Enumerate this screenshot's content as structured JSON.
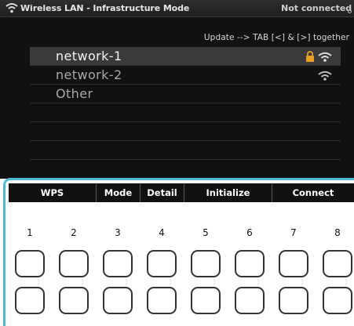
{
  "titlebar": {
    "title": "Wireless LAN - Infrastructure Mode",
    "status": "Not connected",
    "icon": "wifi-icon"
  },
  "hint": "Update --> TAB [<] & [>] together",
  "networks": [
    {
      "name": "network-1",
      "selected": true,
      "locked": true,
      "signal": true
    },
    {
      "name": "network-2",
      "selected": false,
      "locked": false,
      "signal": true
    },
    {
      "name": "Other",
      "selected": false,
      "locked": false,
      "signal": false
    }
  ],
  "menu": {
    "wps": "WPS",
    "mode": "Mode",
    "detail": "Detail",
    "initialize": "Initialize",
    "connect": "Connect"
  },
  "knobs": [
    "1",
    "2",
    "3",
    "4",
    "5",
    "6",
    "7",
    "8"
  ],
  "colors": {
    "panel_border": "#4fb8d6",
    "lock": "#e8a020",
    "screen_bg": "#111111"
  }
}
